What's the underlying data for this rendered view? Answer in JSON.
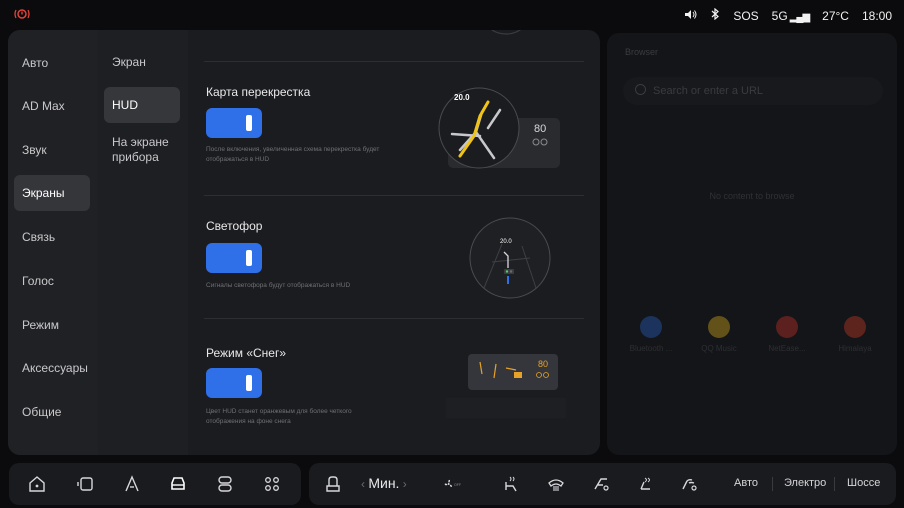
{
  "status": {
    "left_icon": "tire-pressure-warning-icon",
    "sos": "SOS",
    "network": "5G",
    "temperature": "27°C",
    "time": "18:00"
  },
  "browser": {
    "title": "Browser",
    "search_placeholder": "Search or enter a URL",
    "empty_text": "No content to browse",
    "apps": [
      {
        "label": "Bluetooth ..."
      },
      {
        "label": "QQ Music"
      },
      {
        "label": "NetEase..."
      },
      {
        "label": "Himalaya"
      }
    ]
  },
  "nav_primary": {
    "items": [
      {
        "label": "Авто"
      },
      {
        "label": "AD Max"
      },
      {
        "label": "Звук"
      },
      {
        "label": "Экраны"
      },
      {
        "label": "Связь"
      },
      {
        "label": "Голос"
      },
      {
        "label": "Режим"
      },
      {
        "label": "Аксессуары"
      },
      {
        "label": "Общие"
      }
    ],
    "active_index": 3
  },
  "nav_secondary": {
    "items": [
      {
        "label": "Экран"
      },
      {
        "label": "HUD"
      },
      {
        "label": "На экране прибора"
      }
    ],
    "active_index": 1
  },
  "settings": [
    {
      "title": "Карта перекрестка",
      "enabled": true,
      "description": "После включения, увеличенная схема перекрестка будет отображаться в HUD",
      "preview_distance": "20.0",
      "preview_speed": "80"
    },
    {
      "title": "Светофор",
      "enabled": true,
      "description": "Сигналы светофора будут отображаться в HUD",
      "preview_distance": "20.0"
    },
    {
      "title": "Режим «Снег»",
      "enabled": true,
      "description": "Цвет HUD станет оранжевым для более четкого отображения на фоне снега",
      "preview_speed": "80"
    }
  ],
  "dock": {
    "temp_label": "Мин.",
    "fan_label": "OFF",
    "modes": [
      "Авто",
      "Электро",
      "Шоссе"
    ]
  }
}
